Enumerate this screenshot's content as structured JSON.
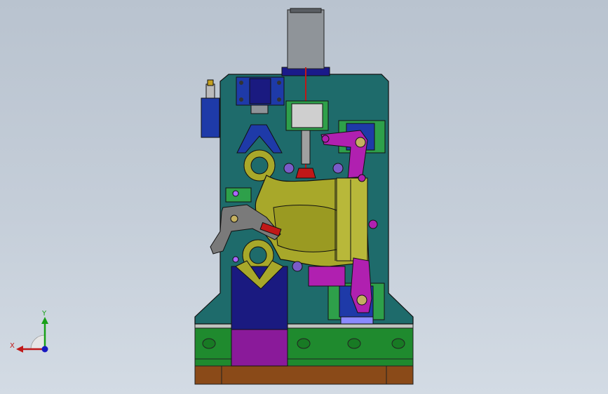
{
  "viewport": {
    "background_top": "#b9c3cf",
    "background_bottom": "#d3dbe4"
  },
  "model": {
    "colors": {
      "base_plate": "#1e6b6b",
      "base_green": "#1f8a2e",
      "base_brown": "#8a4a18",
      "motor_gray": "#8f9499",
      "motor_cap": "#1a1a8a",
      "casting_yellow": "#a8a82a",
      "clamp_magenta": "#b020b0",
      "support_navy": "#1a1a80",
      "support_purple": "#8a1a9a",
      "bracket_blue": "#1e3aa8",
      "bracket_green": "#2ea04a",
      "arm_gray": "#7a7a7a",
      "pin_red": "#c01818"
    }
  },
  "triad": {
    "x_label": "X",
    "y_label": "Y",
    "x_color": "#c01818",
    "y_color": "#18a018",
    "z_color": "#1818c0"
  }
}
